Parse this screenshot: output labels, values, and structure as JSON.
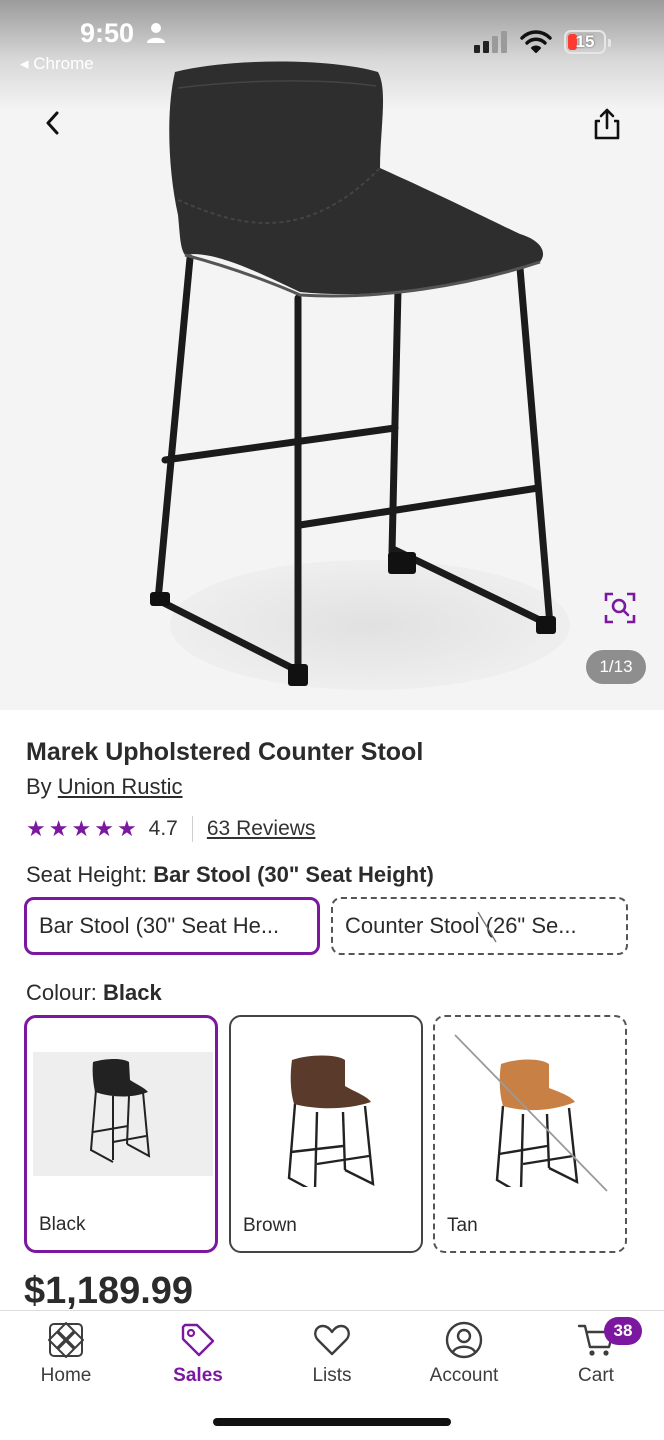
{
  "status_bar": {
    "time": "9:50",
    "back_app": "◂ Chrome",
    "battery": "15",
    "battery_level": 0.15,
    "battery_color": "#ff3b30"
  },
  "hero": {
    "counter": "1/13"
  },
  "product": {
    "title": "Marek Upholstered Counter Stool",
    "by_prefix": "By ",
    "brand": "Union Rustic",
    "rating": "4.7",
    "rating_value": 4.7,
    "reviews": "63 Reviews",
    "price": "$1,189.99"
  },
  "seat_height": {
    "label": "Seat Height: ",
    "selected_value": "Bar Stool (30\" Seat Height)",
    "options": [
      {
        "label": "Bar Stool (30\" Seat He...",
        "state": "selected"
      },
      {
        "label": "Counter Stool (26\" Se...",
        "state": "unavailable"
      }
    ]
  },
  "colour": {
    "label": "Colour: ",
    "selected_value": "Black",
    "options": [
      {
        "label": "Black",
        "state": "selected",
        "seat_color": "#222222"
      },
      {
        "label": "Brown",
        "state": "available",
        "seat_color": "#5a3a2a"
      },
      {
        "label": "Tan",
        "state": "unavailable",
        "seat_color": "#c98044"
      }
    ]
  },
  "bottom_nav": {
    "items": [
      {
        "label": "Home",
        "icon": "home-icon"
      },
      {
        "label": "Sales",
        "icon": "tag-icon",
        "active": true
      },
      {
        "label": "Lists",
        "icon": "heart-icon"
      },
      {
        "label": "Account",
        "icon": "account-icon"
      },
      {
        "label": "Cart",
        "icon": "cart-icon",
        "badge": "38"
      }
    ]
  },
  "colors": {
    "accent": "#7b189f"
  }
}
